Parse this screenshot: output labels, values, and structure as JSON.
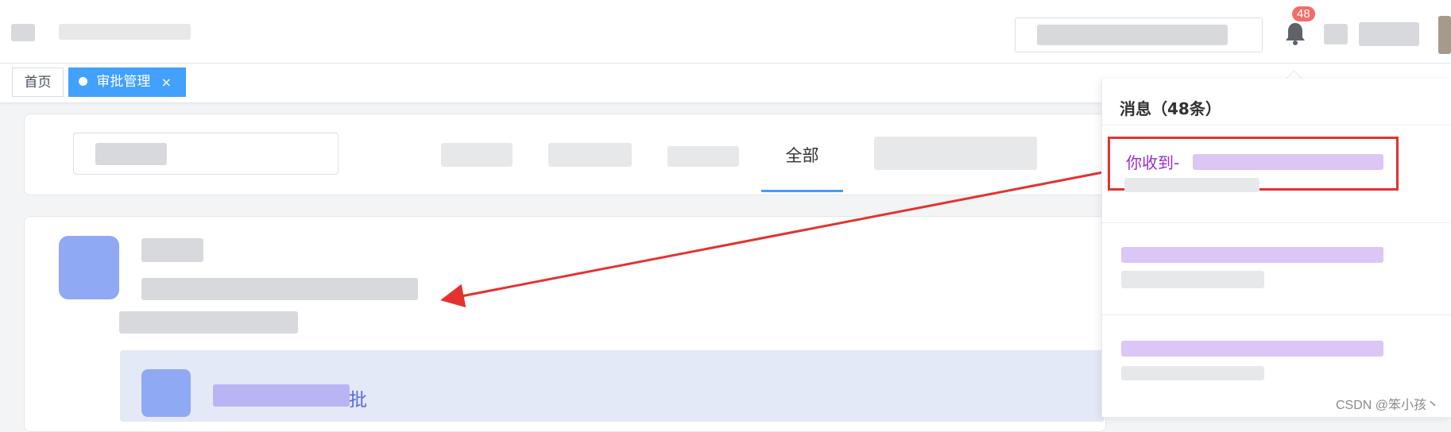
{
  "header": {
    "notifications_count": "48"
  },
  "tabs": [
    {
      "label": "首页",
      "active": false
    },
    {
      "label": "审批管理",
      "active": true,
      "close": "×"
    }
  ],
  "filter": {
    "active_tab": "全部"
  },
  "content": {
    "approval_text": "批"
  },
  "messages": {
    "title": "消息（48条）",
    "first_item_text": "你收到-"
  },
  "watermark": "CSDN @笨小孩丶",
  "colors": {
    "accent": "#42a1ff",
    "badge": "#f56c6c",
    "highlight_border": "#e3332f",
    "message_link": "#9a2bd8"
  }
}
